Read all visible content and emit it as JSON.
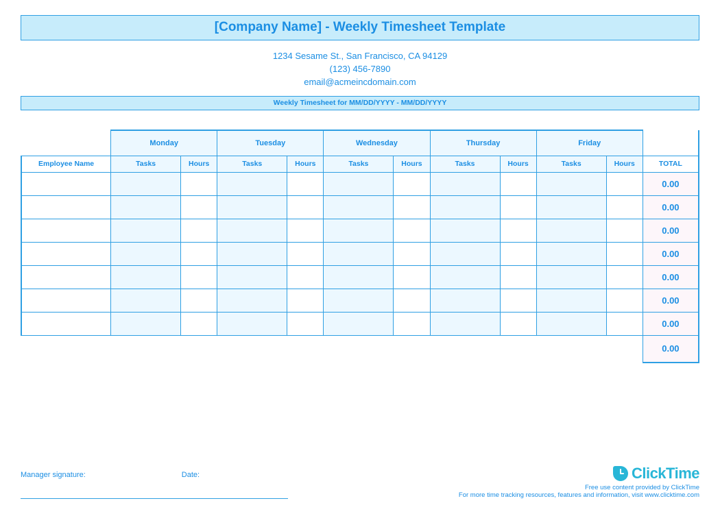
{
  "title": "[Company Name] - Weekly Timesheet Template",
  "contact": {
    "address": "1234 Sesame St.,  San Francisco, CA 94129",
    "phone": "(123) 456-7890",
    "email": "email@acmeincdomain.com"
  },
  "period_label": "Weekly Timesheet for MM/DD/YYYY - MM/DD/YYYY",
  "columns": {
    "employee": "Employee Name",
    "tasks": "Tasks",
    "hours": "Hours",
    "total": "TOTAL"
  },
  "days": [
    "Monday",
    "Tuesday",
    "Wednesday",
    "Thursday",
    "Friday"
  ],
  "rows": [
    {
      "employee": "",
      "cells": [
        "",
        "",
        "",
        "",
        "",
        "",
        "",
        "",
        "",
        ""
      ],
      "total": "0.00"
    },
    {
      "employee": "",
      "cells": [
        "",
        "",
        "",
        "",
        "",
        "",
        "",
        "",
        "",
        ""
      ],
      "total": "0.00"
    },
    {
      "employee": "",
      "cells": [
        "",
        "",
        "",
        "",
        "",
        "",
        "",
        "",
        "",
        ""
      ],
      "total": "0.00"
    },
    {
      "employee": "",
      "cells": [
        "",
        "",
        "",
        "",
        "",
        "",
        "",
        "",
        "",
        ""
      ],
      "total": "0.00"
    },
    {
      "employee": "",
      "cells": [
        "",
        "",
        "",
        "",
        "",
        "",
        "",
        "",
        "",
        ""
      ],
      "total": "0.00"
    },
    {
      "employee": "",
      "cells": [
        "",
        "",
        "",
        "",
        "",
        "",
        "",
        "",
        "",
        ""
      ],
      "total": "0.00"
    },
    {
      "employee": "",
      "cells": [
        "",
        "",
        "",
        "",
        "",
        "",
        "",
        "",
        "",
        ""
      ],
      "total": "0.00"
    }
  ],
  "grand_total": "0.00",
  "footer": {
    "manager_signature_label": "Manager signature:",
    "date_label": "Date:"
  },
  "brand": {
    "name": "ClickTime",
    "line1": "Free use content provided by ClickTime",
    "line2": "For more time tracking resources, features and information, visit www.clicktime.com"
  }
}
